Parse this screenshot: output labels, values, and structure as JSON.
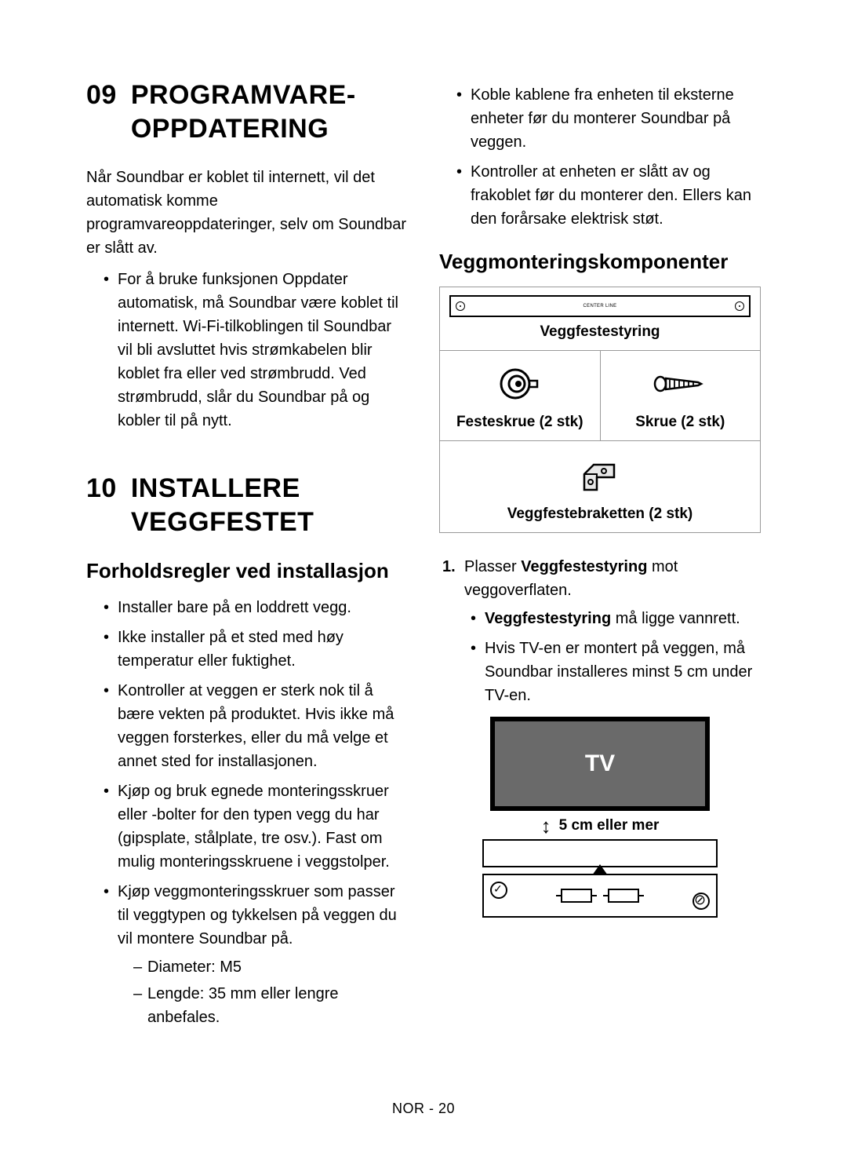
{
  "sections": {
    "s09": {
      "number": "09",
      "title": "PROGRAMVARE-OPPDATERING",
      "intro": "Når Soundbar er koblet til internett, vil det automatisk komme programvareoppdateringer, selv om Soundbar er slått av.",
      "bullets": [
        "For å bruke funksjonen Oppdater automatisk, må Soundbar være koblet til internett. Wi-Fi-tilkoblingen til Soundbar vil bli avsluttet hvis strømkabelen blir koblet fra eller ved strømbrudd. Ved strømbrudd, slår du Soundbar på og kobler til på nytt."
      ]
    },
    "s10": {
      "number": "10",
      "title": "INSTALLERE VEGGFESTET",
      "precautions_heading": "Forholdsregler ved installasjon",
      "precautions": [
        {
          "text": "Installer bare på en loddrett vegg."
        },
        {
          "text": "Ikke installer på et sted med høy temperatur eller fuktighet."
        },
        {
          "text": "Kontroller at veggen er sterk nok til å bære vekten på produktet. Hvis ikke må veggen forsterkes, eller du må velge et annet sted for installasjonen."
        },
        {
          "text": "Kjøp og bruk egnede monteringsskruer eller -bolter for den typen vegg du har (gipsplate, stålplate, tre osv.). Fast om mulig monteringsskruene i veggstolper."
        },
        {
          "text": "Kjøp veggmonteringsskruer som passer til veggtypen og tykkelsen på veggen du vil montere Soundbar på.",
          "sub": [
            "Diameter: M5",
            "Lengde: 35 mm eller lengre anbefales."
          ]
        }
      ]
    },
    "right_bullets": [
      "Koble kablene fra enheten til eksterne enheter før du monterer Soundbar på veggen.",
      "Kontroller at enheten er slått av og frakoblet før du monterer den. Ellers kan den forårsake elektrisk støt."
    ],
    "components": {
      "heading": "Veggmonteringskomponenter",
      "guide_label": "Veggfestestyring",
      "holder_screw": "Festeskrue (2 stk)",
      "screw": "Skrue (2 stk)",
      "bracket": "Veggfestebraketten (2 stk)"
    },
    "step1": {
      "number": "1.",
      "text_before": "Plasser ",
      "bold1": "Veggfestestyring",
      "text_after": " mot veggoverflaten.",
      "sub_bold": "Veggfestestyring",
      "sub1_after": " må ligge vannrett.",
      "sub2": "Hvis TV-en er montert på veggen, må Soundbar installeres minst 5 cm under TV-en."
    },
    "diagram": {
      "tv_label": "TV",
      "gap_label": "5 cm eller mer"
    },
    "footer": "NOR - 20"
  }
}
